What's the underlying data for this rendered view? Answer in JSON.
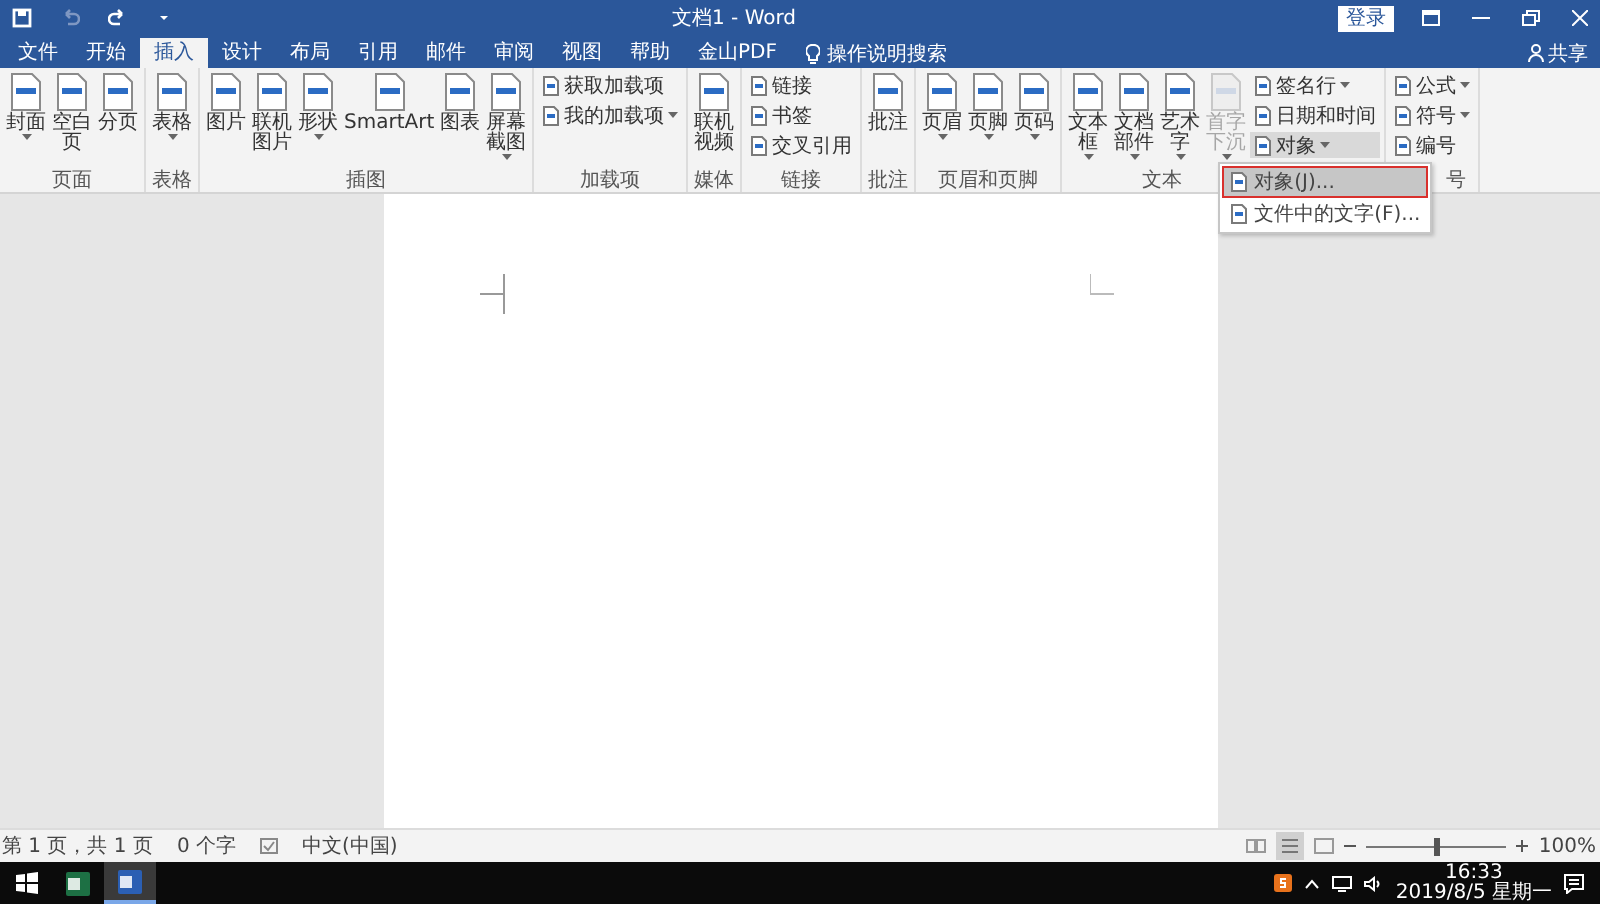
{
  "title_bar": {
    "quick_access": [
      {
        "kind": "save",
        "disabled": false
      },
      {
        "kind": "undo",
        "disabled": true
      },
      {
        "kind": "redo",
        "disabled": false
      },
      {
        "kind": "customize",
        "disabled": false
      }
    ],
    "title": "文档1 - Word",
    "login": "登录"
  },
  "tabs": [
    {
      "label": "文件",
      "selected": false
    },
    {
      "label": "开始",
      "selected": false
    },
    {
      "label": "插入",
      "selected": true
    },
    {
      "label": "设计",
      "selected": false
    },
    {
      "label": "布局",
      "selected": false
    },
    {
      "label": "引用",
      "selected": false
    },
    {
      "label": "邮件",
      "selected": false
    },
    {
      "label": "审阅",
      "selected": false
    },
    {
      "label": "视图",
      "selected": false
    },
    {
      "label": "帮助",
      "selected": false
    },
    {
      "label": "金山PDF",
      "selected": false
    }
  ],
  "tell_me": "操作说明搜索",
  "share": "共享",
  "ribbon_groups": [
    {
      "label": "页面",
      "items": [
        {
          "kind": "large",
          "label": "封面",
          "dropdown": true,
          "disabled": false
        },
        {
          "kind": "large",
          "label": "空白页",
          "dropdown": false,
          "disabled": false
        },
        {
          "kind": "large",
          "label": "分页",
          "dropdown": false,
          "disabled": false
        }
      ]
    },
    {
      "label": "表格",
      "items": [
        {
          "kind": "large",
          "label": "表格",
          "dropdown": true,
          "disabled": false
        }
      ]
    },
    {
      "label": "插图",
      "items": [
        {
          "kind": "large",
          "label": "图片",
          "dropdown": false,
          "disabled": false
        },
        {
          "kind": "large",
          "label": "联机图片",
          "dropdown": false,
          "disabled": false
        },
        {
          "kind": "large",
          "label": "形状",
          "dropdown": true,
          "disabled": false
        },
        {
          "kind": "large",
          "label": "SmartArt",
          "dropdown": false,
          "disabled": false
        },
        {
          "kind": "large",
          "label": "图表",
          "dropdown": false,
          "disabled": false
        },
        {
          "kind": "large",
          "label": "屏幕截图",
          "dropdown": true,
          "disabled": false
        }
      ]
    },
    {
      "label": "加载项",
      "items": [
        {
          "kind": "small",
          "label": "获取加载项",
          "dropdown": false,
          "disabled": false
        },
        {
          "kind": "small",
          "label": "我的加载项",
          "dropdown": true,
          "disabled": false
        }
      ]
    },
    {
      "label": "媒体",
      "items": [
        {
          "kind": "large",
          "label": "联机视频",
          "dropdown": false,
          "disabled": false
        }
      ]
    },
    {
      "label": "链接",
      "items": [
        {
          "kind": "small",
          "label": "链接",
          "dropdown": false,
          "disabled": false
        },
        {
          "kind": "small",
          "label": "书签",
          "dropdown": false,
          "disabled": false
        },
        {
          "kind": "small",
          "label": "交叉引用",
          "dropdown": false,
          "disabled": false
        }
      ]
    },
    {
      "label": "批注",
      "items": [
        {
          "kind": "large",
          "label": "批注",
          "dropdown": false,
          "disabled": false
        }
      ]
    },
    {
      "label": "页眉和页脚",
      "items": [
        {
          "kind": "large",
          "label": "页眉",
          "dropdown": true,
          "disabled": false
        },
        {
          "kind": "large",
          "label": "页脚",
          "dropdown": true,
          "disabled": false
        },
        {
          "kind": "large",
          "label": "页码",
          "dropdown": true,
          "disabled": false
        }
      ]
    },
    {
      "label": "文本",
      "items": [
        {
          "kind": "large",
          "label": "文本框",
          "dropdown": true,
          "disabled": false
        },
        {
          "kind": "large",
          "label": "文档部件",
          "dropdown": true,
          "disabled": false
        },
        {
          "kind": "large",
          "label": "艺术字",
          "dropdown": true,
          "disabled": false
        },
        {
          "kind": "large",
          "label": "首字下沉",
          "dropdown": true,
          "disabled": true
        },
        {
          "kind": "small",
          "label": "签名行",
          "dropdown": true,
          "disabled": false
        },
        {
          "kind": "small",
          "label": "日期和时间",
          "dropdown": false,
          "disabled": false
        },
        {
          "kind": "small",
          "label": "对象",
          "dropdown": true,
          "disabled": false,
          "open": true
        }
      ]
    },
    {
      "label": "号",
      "items": [
        {
          "kind": "small",
          "label": "公式",
          "dropdown": true,
          "disabled": false
        },
        {
          "kind": "small",
          "label": "符号",
          "dropdown": true,
          "disabled": false
        },
        {
          "kind": "small",
          "label": "编号",
          "dropdown": false,
          "disabled": false
        }
      ]
    }
  ],
  "object_menu": [
    {
      "label": "对象(J)...",
      "selected": true
    },
    {
      "label": "文件中的文字(F)...",
      "selected": false
    }
  ],
  "status_bar": {
    "page": "第 1 页，共 1 页",
    "words": "0 个字",
    "language": "中文(中国)",
    "zoom": "100%",
    "level": 0.5
  },
  "taskbar": {
    "apps": [
      {
        "kind": "excel",
        "selected": false
      },
      {
        "kind": "word",
        "selected": true
      }
    ],
    "time": "16:33",
    "date": "2019/8/5 星期一"
  }
}
